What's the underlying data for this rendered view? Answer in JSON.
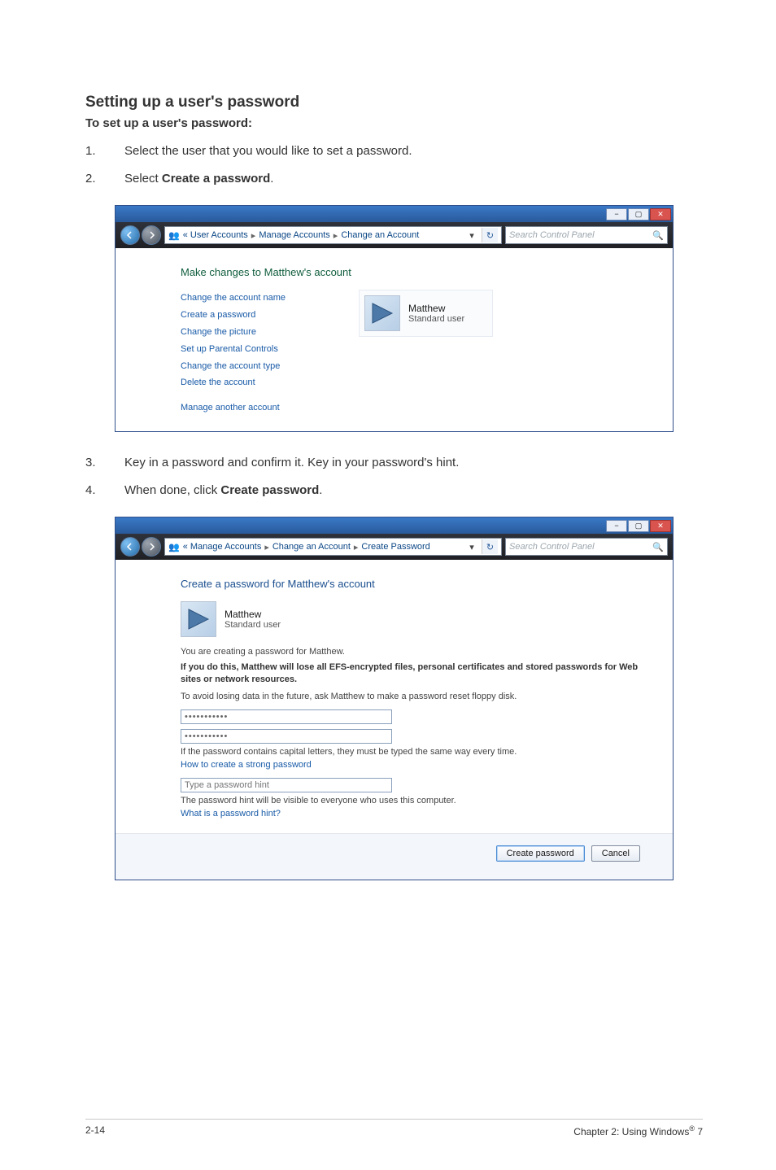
{
  "heading": "Setting up a user's password",
  "subheading": "To set up a user's password:",
  "steps_a": [
    {
      "num": "1.",
      "text": "Select the user that you would like to set a password."
    },
    {
      "num": "2.",
      "text_pre": "Select ",
      "bold": "Create a password",
      "suffix": "."
    }
  ],
  "steps_b": [
    {
      "num": "3.",
      "text": "Key in a password and confirm it. Key in your password's hint."
    },
    {
      "num": "4.",
      "text_pre": "When done, click ",
      "bold": "Create password",
      "suffix": "."
    }
  ],
  "screenshot1": {
    "breadcrumbs": [
      "« User Accounts",
      "Manage Accounts",
      "Change an Account"
    ],
    "search_placeholder": "Search Control Panel",
    "section_title": "Make changes to Matthew's account",
    "links": [
      "Change the account name",
      "Create a password",
      "Change the picture",
      "Set up Parental Controls",
      "Change the account type",
      "Delete the account"
    ],
    "manage_link": "Manage another account",
    "user": {
      "name": "Matthew",
      "role": "Standard user"
    }
  },
  "screenshot2": {
    "breadcrumbs": [
      "« Manage Accounts",
      "Change an Account",
      "Create Password"
    ],
    "search_placeholder": "Search Control Panel",
    "section_title": "Create a password for Matthew's account",
    "user": {
      "name": "Matthew",
      "role": "Standard user"
    },
    "line_creating": "You are creating a password for Matthew.",
    "bold_warn": "If you do this, Matthew will lose all EFS-encrypted files, personal certificates and stored passwords for Web sites or network resources.",
    "avoid_line": "To avoid losing data in the future, ask Matthew to make a password reset floppy disk.",
    "pw_value": "•••••••••••",
    "pw_confirm_value": "•••••••••••",
    "cap_note": "If the password contains capital letters, they must be typed the same way every time.",
    "strong_link": "How to create a strong password",
    "hint_placeholder": "Type a password hint",
    "hint_note": "The password hint will be visible to everyone who uses this computer.",
    "what_hint_link": "What is a password hint?",
    "btn_create": "Create password",
    "btn_cancel": "Cancel"
  },
  "footer": {
    "left": "2-14",
    "right_pre": "Chapter 2: Using Windows",
    "right_suffix": " 7"
  }
}
